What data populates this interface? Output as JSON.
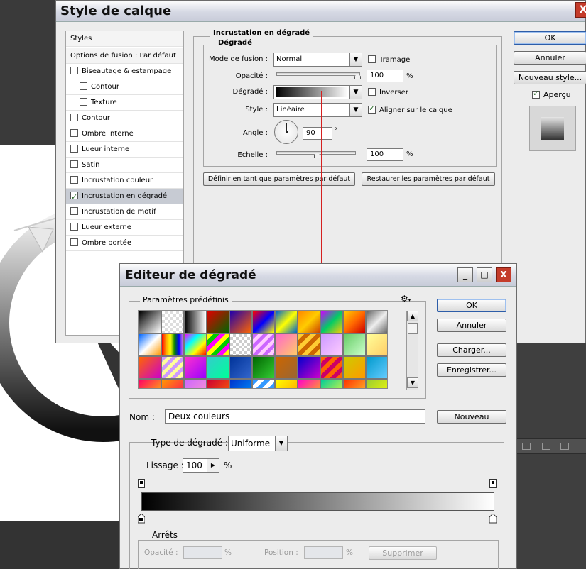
{
  "layer_style": {
    "title": "Style de calque",
    "close": "X",
    "styles_header": "Styles",
    "blend_options": "Options de fusion : Par défaut",
    "items": [
      {
        "label": "Biseautage & estampage",
        "checked": false,
        "indent": false
      },
      {
        "label": "Contour",
        "checked": false,
        "indent": true
      },
      {
        "label": "Texture",
        "checked": false,
        "indent": true
      },
      {
        "label": "Contour",
        "checked": false,
        "indent": false
      },
      {
        "label": "Ombre interne",
        "checked": false,
        "indent": false
      },
      {
        "label": "Lueur interne",
        "checked": false,
        "indent": false
      },
      {
        "label": "Satin",
        "checked": false,
        "indent": false
      },
      {
        "label": "Incrustation couleur",
        "checked": false,
        "indent": false
      },
      {
        "label": "Incrustation en dégradé",
        "checked": true,
        "indent": false,
        "selected": true
      },
      {
        "label": "Incrustation de motif",
        "checked": false,
        "indent": false
      },
      {
        "label": "Lueur externe",
        "checked": false,
        "indent": false
      },
      {
        "label": "Ombre portée",
        "checked": false,
        "indent": false
      }
    ],
    "section_title": "Incrustation en dégradé",
    "group_title": "Dégradé",
    "blend_mode_label": "Mode de fusion :",
    "blend_mode_value": "Normal",
    "dither_label": "Tramage",
    "opacity_label": "Opacité :",
    "opacity_value": "100",
    "opacity_unit": "%",
    "opacity_level": 1.0,
    "gradient_label": "Dégradé :",
    "reverse_label": "Inverser",
    "style_label": "Style :",
    "style_value": "Linéaire",
    "align_label": "Aligner sur le calque",
    "align_checked": true,
    "angle_label": "Angle :",
    "angle_value": "90",
    "angle_unit": "°",
    "scale_label": "Echelle :",
    "scale_value": "100",
    "scale_unit": "%",
    "scale_level": 0.5,
    "btn_set_default": "Définir en tant que paramètres par défaut",
    "btn_reset_default": "Restaurer les paramètres par défaut",
    "btn_ok": "OK",
    "btn_cancel": "Annuler",
    "btn_new_style": "Nouveau style...",
    "preview_label": "Aperçu",
    "preview_checked": true
  },
  "gradient_editor": {
    "title": "Editeur de dégradé",
    "minimize": "_",
    "maximize": "□",
    "close": "X",
    "presets_label": "Paramètres prédéfinis",
    "presets_menu_icon": "gear-icon",
    "btn_ok": "OK",
    "btn_cancel": "Annuler",
    "btn_load": "Charger...",
    "btn_save": "Enregistrer...",
    "name_label": "Nom :",
    "name_value": "Deux couleurs",
    "btn_new": "Nouveau",
    "type_label": "Type de dégradé :",
    "type_value": "Uniforme",
    "smooth_label": "Lissage :",
    "smooth_value": "100",
    "smooth_unit": "%",
    "stops_label": "Arrêts",
    "opacity_label": "Opacité :",
    "opacity_unit": "%",
    "position_label": "Position :",
    "position_unit": "%",
    "btn_delete": "Supprimer",
    "colors": {
      "start": "#000000",
      "end": "#ffffff"
    }
  }
}
